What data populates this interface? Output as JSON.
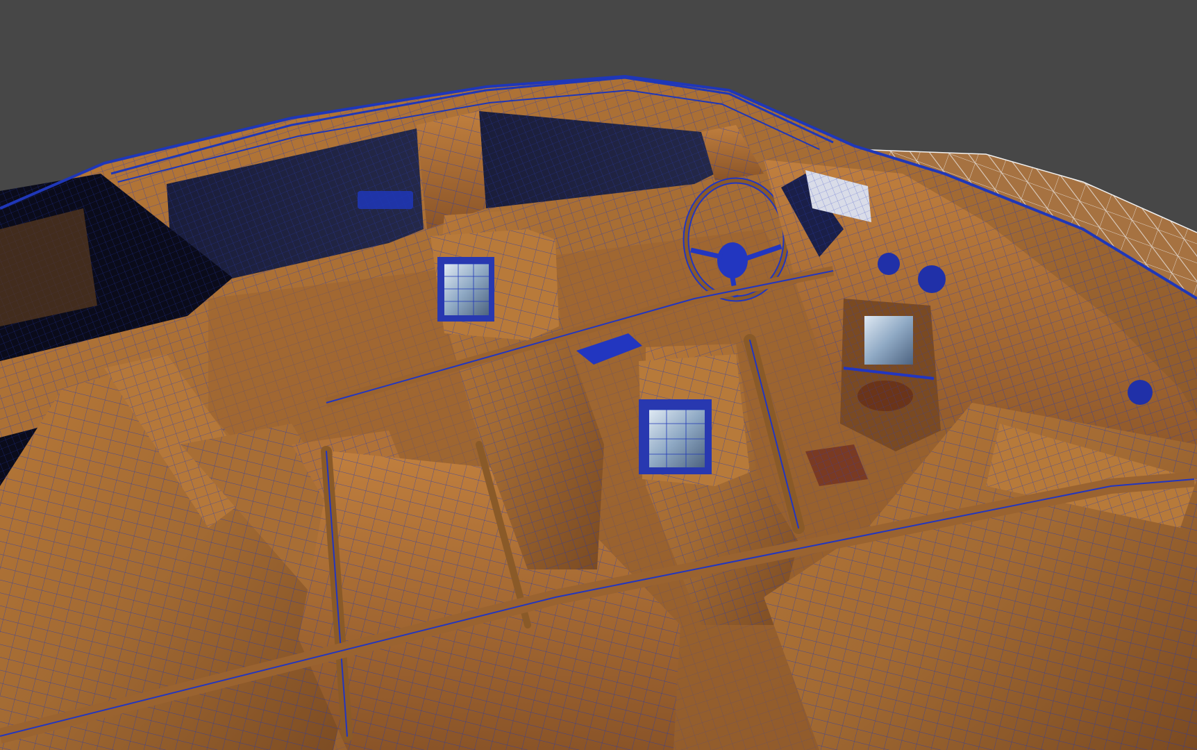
{
  "viewport": {
    "type": "3d-perspective-viewport",
    "shading": "shaded-with-wireframe",
    "subject": "vehicle-interior-model",
    "navigable": true
  },
  "colors": {
    "background": "#474747",
    "wireframe": "#1f37b8",
    "wireframe_selected": "#f2f2f2",
    "leather": "#a26a33",
    "leather_shadow": "#6b4020",
    "leather_highlight": "#c07f3e",
    "glass_dark": "#10142e",
    "roof_black": "#0a0b1a",
    "screen": "#9fb8d0",
    "wood_trim": "#7a3a22"
  },
  "icons": {
    "headrest_screen_left": "monitor-icon",
    "headrest_screen_right": "monitor-icon",
    "nav_display": "display-icon",
    "steering_wheel": "steering-wheel-icon"
  }
}
